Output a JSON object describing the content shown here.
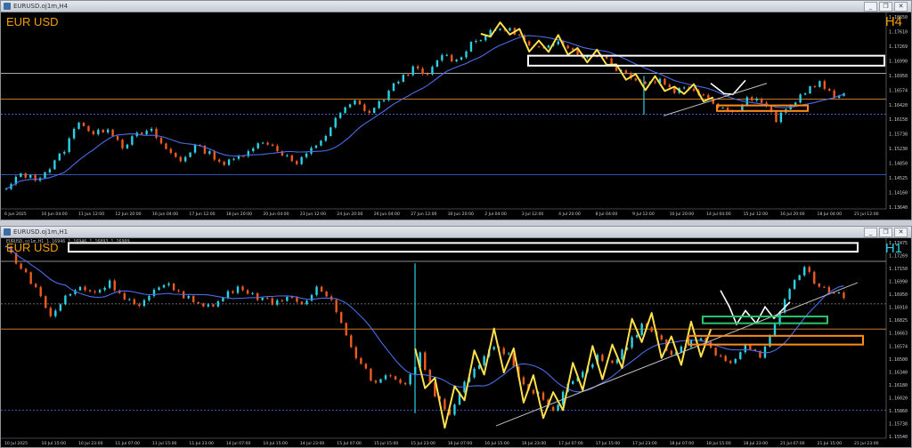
{
  "colors": {
    "bull": "#2bd1e6",
    "bear": "#ef5a1f",
    "ma": "#4a6de8",
    "zigzag": "#ffe14a",
    "hline": "#e08a2c",
    "res": "#ffffff",
    "orange": "#ff8c1a",
    "green": "#29c46b",
    "trend": "#c0c0c0",
    "grid": "#4a5a68"
  },
  "charts": [
    {
      "window_title": "EURUSD.oj1m,H4",
      "symbol": "EUR USD",
      "timeframe": "H4",
      "tf_color": "#f0a000",
      "ohlc": "",
      "price_labels": [
        "1.18650",
        "1.17610",
        "1.17269",
        "1.16990",
        "1.16950",
        "1.16574",
        "1.16420",
        "1.16158",
        "1.15738",
        "1.15230",
        "1.14850",
        "1.14525",
        "1.14160",
        "1.13640"
      ],
      "time_labels": [
        "6 Jun 2025",
        "10 Jun 04:00",
        "11 Jun 12:00",
        "12 Jun 20:00",
        "16 Jun 04:00",
        "17 Jun 12:00",
        "18 Jun 20:00",
        "20 Jun 04:00",
        "23 Jun 12:00",
        "24 Jun 20:00",
        "26 Jun 04:00",
        "27 Jun 12:00",
        "30 Jun 20:00",
        "2 Jul 04:00",
        "3 Jul 12:00",
        "4 Jul 20:00",
        "8 Jul 04:00",
        "9 Jul 12:00",
        "10 Jul 20:00",
        "14 Jul 04:00",
        "15 Jul 12:00",
        "16 Jul 20:00",
        "18 Jul 04:00",
        "21 Jul 12:00"
      ],
      "chart_data": {
        "type": "candlestick",
        "ylim": [
          1.1364,
          1.189
        ],
        "grid": false,
        "series": [
          {
            "name": "",
            "values": [
              1.141,
              1.1455,
              1.144,
              1.147,
              1.152,
              1.16,
              1.156,
              1.158,
              1.153,
              1.156,
              1.157,
              1.152,
              1.149,
              1.153,
              1.151,
              1.148,
              1.15,
              1.153,
              1.154,
              1.151,
              1.148,
              1.152,
              1.156,
              1.162,
              1.165,
              1.162,
              1.166,
              1.171,
              1.174,
              1.172,
              1.178,
              1.176,
              1.181,
              1.183,
              1.185,
              1.184,
              1.18,
              1.179,
              1.182,
              1.179,
              1.177,
              1.178,
              1.174,
              1.172,
              1.17,
              1.171,
              1.168,
              1.169,
              1.167,
              1.164,
              1.162,
              1.166,
              1.165,
              1.16,
              1.164,
              1.168,
              1.17,
              1.166,
              1.169
            ]
          }
        ]
      }
    },
    {
      "window_title": "EURUSD.oj1m,H1",
      "symbol": "EUR USD",
      "timeframe": "H1",
      "tf_color": "#2bd1e6",
      "ohlc": "EURUSD.oj1m,H1  1.16946 1.16946 1.16893 1.16909",
      "price_labels": [
        "1.17475",
        "1.17269",
        "1.17150",
        "1.16990",
        "1.16950",
        "1.16910",
        "1.16825",
        "1.16663",
        "1.16574",
        "1.16500",
        "1.16340",
        "1.16180",
        "1.16020",
        "1.15860",
        "1.15738",
        "1.15540"
      ],
      "time_labels": [
        "10 Jul 2025",
        "10 Jul 15:00",
        "10 Jul 23:00",
        "11 Jul 07:00",
        "11 Jul 15:00",
        "11 Jul 23:00",
        "14 Jul 07:00",
        "14 Jul 15:00",
        "14 Jul 23:00",
        "15 Jul 07:00",
        "15 Jul 15:00",
        "15 Jul 23:00",
        "16 Jul 07:00",
        "16 Jul 15:00",
        "16 Jul 23:00",
        "17 Jul 07:00",
        "17 Jul 15:00",
        "17 Jul 23:00",
        "18 Jul 07:00",
        "18 Jul 15:00",
        "18 Jul 23:00",
        "21 Jul 07:00",
        "21 Jul 15:00",
        "21 Jul 23:00"
      ],
      "chart_data": {
        "type": "candlestick",
        "ylim": [
          1.1546,
          1.175
        ],
        "grid": false,
        "series": [
          {
            "name": "",
            "values": [
              1.1742,
              1.172,
              1.17,
              1.167,
              1.169,
              1.17,
              1.1695,
              1.1705,
              1.169,
              1.168,
              1.1695,
              1.1705,
              1.169,
              1.1685,
              1.168,
              1.1695,
              1.17,
              1.169,
              1.1685,
              1.169,
              1.168,
              1.17,
              1.169,
              1.165,
              1.162,
              1.16,
              1.161,
              1.16,
              1.163,
              1.159,
              1.157,
              1.16,
              1.162,
              1.164,
              1.163,
              1.16,
              1.159,
              1.157,
              1.16,
              1.161,
              1.163,
              1.162,
              1.164,
              1.166,
              1.165,
              1.163,
              1.164,
              1.165,
              1.163,
              1.162,
              1.164,
              1.163,
              1.166,
              1.17,
              1.172,
              1.17,
              1.1695,
              1.169
            ]
          }
        ]
      }
    }
  ]
}
